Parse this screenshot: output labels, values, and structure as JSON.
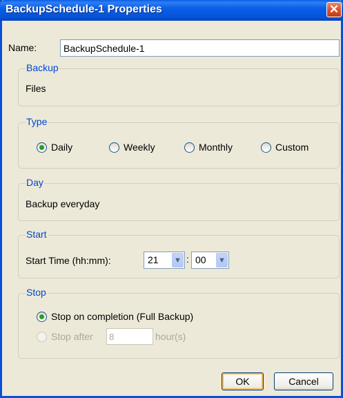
{
  "window": {
    "title": "BackupSchedule-1 Properties",
    "close_glyph": "✕"
  },
  "name": {
    "label": "Name:",
    "value": "BackupSchedule-1"
  },
  "backup": {
    "title": "Backup",
    "value": "Files"
  },
  "type": {
    "title": "Type",
    "options": [
      {
        "label": "Daily",
        "checked": true
      },
      {
        "label": "Weekly",
        "checked": false
      },
      {
        "label": "Monthly",
        "checked": false
      },
      {
        "label": "Custom",
        "checked": false
      }
    ]
  },
  "day": {
    "title": "Day",
    "value": "Backup everyday"
  },
  "start": {
    "title": "Start",
    "label": "Start Time (hh:mm):",
    "hour": "21",
    "separator": ":",
    "minute": "00"
  },
  "stop": {
    "title": "Stop",
    "on_completion_label": "Stop on completion (Full Backup)",
    "on_completion_checked": true,
    "after_label": "Stop after",
    "after_value": "8",
    "after_unit": "hour(s)",
    "after_enabled": false
  },
  "buttons": {
    "ok": "OK",
    "cancel": "Cancel"
  },
  "icons": {
    "dropdown": "chevron-down-icon",
    "close": "close-icon"
  }
}
